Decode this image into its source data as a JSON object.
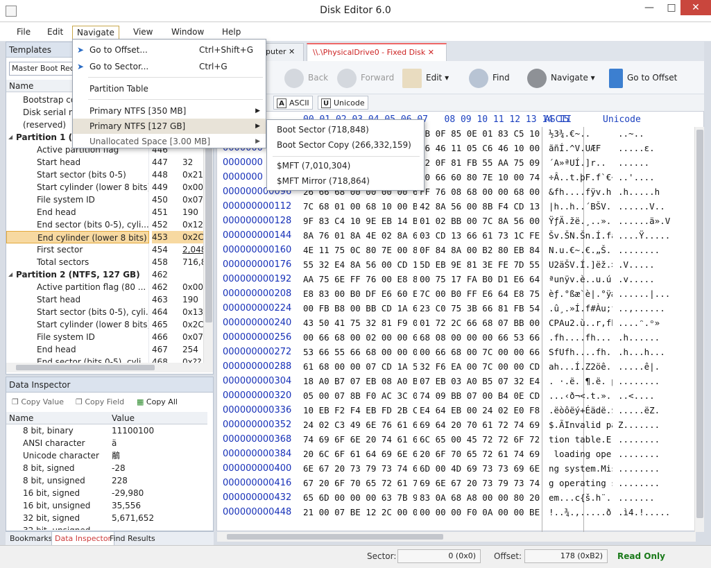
{
  "app": {
    "title": "Disk Editor 6.0"
  },
  "menubar": [
    "File",
    "Edit",
    "Navigate",
    "View",
    "Window",
    "Help"
  ],
  "templates": {
    "header": "Templates",
    "selected": "Master Boot Record",
    "col_name": "Name",
    "rows": [
      {
        "name": "Bootstrap co",
        "off": "",
        "val": "",
        "type": "item"
      },
      {
        "name": "Disk serial nun",
        "off": "",
        "val": "",
        "type": "item"
      },
      {
        "name": "(reserved)",
        "off": "",
        "val": "",
        "type": "item"
      },
      {
        "name": "Partition 1 (",
        "off": "",
        "val": "",
        "type": "group"
      },
      {
        "name": "Active partition flag",
        "off": "446",
        "val": "",
        "type": "sub"
      },
      {
        "name": "Start head",
        "off": "447",
        "val": "32",
        "type": "sub"
      },
      {
        "name": "Start sector (bits 0-5)",
        "off": "448",
        "val": "0x21",
        "type": "sub"
      },
      {
        "name": "Start cylinder (lower 8 bits)",
        "off": "449",
        "val": "0x00",
        "type": "sub"
      },
      {
        "name": "File system ID",
        "off": "450",
        "val": "0x07",
        "type": "sub"
      },
      {
        "name": "End head",
        "off": "451",
        "val": "190",
        "type": "sub"
      },
      {
        "name": "End sector (bits 0-5), cyli...",
        "off": "452",
        "val": "0x12",
        "type": "sub"
      },
      {
        "name": "End cylinder (lower 8 bits)",
        "off": "453",
        "val": "0x2C",
        "type": "hl"
      },
      {
        "name": "First sector",
        "off": "454",
        "val": "2,048",
        "type": "link"
      },
      {
        "name": "Total sectors",
        "off": "458",
        "val": "716,8",
        "type": "sub"
      },
      {
        "name": "Partition 2 (NTFS, 127 GB)",
        "off": "462",
        "val": "",
        "type": "group"
      },
      {
        "name": "Active partition flag (80 ...",
        "off": "462",
        "val": "0x00",
        "type": "sub"
      },
      {
        "name": "Start head",
        "off": "463",
        "val": "190",
        "type": "sub"
      },
      {
        "name": "Start sector (bits 0-5), cyli...",
        "off": "464",
        "val": "0x13",
        "type": "sub"
      },
      {
        "name": "Start cylinder (lower 8 bits)",
        "off": "465",
        "val": "0x2C",
        "type": "sub"
      },
      {
        "name": "File system ID",
        "off": "466",
        "val": "0x07",
        "type": "sub"
      },
      {
        "name": "End head",
        "off": "467",
        "val": "254",
        "type": "sub"
      },
      {
        "name": "End sector (bits 0-5), cyli...",
        "off": "468",
        "val": "0x??",
        "type": "sub"
      }
    ]
  },
  "inspector": {
    "header": "Data Inspector",
    "copy_value": "Copy Value",
    "copy_field": "Copy Field",
    "copy_all": "Copy All",
    "col_name": "Name",
    "col_value": "Value",
    "rows": [
      [
        "8 bit, binary",
        "11100100"
      ],
      [
        "ANSI character",
        "ä"
      ],
      [
        "Unicode character",
        "䳤"
      ],
      [
        "8 bit, signed",
        "-28"
      ],
      [
        "8 bit, unsigned",
        "228"
      ],
      [
        "16 bit, signed",
        "-29,980"
      ],
      [
        "16 bit, unsigned",
        "35,556"
      ],
      [
        "32 bit, signed",
        "5,671,652"
      ],
      [
        "32 bit, unsigned",
        ""
      ]
    ]
  },
  "bottom_tabs": [
    "Bookmarks",
    "Data Inspector",
    "Find Results"
  ],
  "doc_tabs": [
    "puter",
    "\\\\.\\PhysicalDrive0 - Fixed Disk"
  ],
  "toolbar": {
    "back": "Back",
    "forward": "Forward",
    "edit": "Edit",
    "find": "Find",
    "navigate": "Navigate",
    "goto": "Go to Offset"
  },
  "modes": {
    "ascii": "ASCII",
    "unicode": "Unicode"
  },
  "hex": {
    "header_cols": "00 01 02 03 04 05 06 07   08 09 10 11 12 13 14 15",
    "header_ascii": "ASCII",
    "header_unicode": "Unicode",
    "rows": [
      {
        "off": "0000000",
        "h1": "",
        "h2": "0B 0F 85 0E 01 83 C5 10",
        "asc": "½3¾.€~..",
        "uni": "..~.."
      },
      {
        "off": "0000000",
        "h1": "",
        "h2": "C6 46 11 05 C6 46 10 00",
        "asc": "ãñÍ.^V.UÆF",
        "uni": ".....ε."
      },
      {
        "off": "0000000",
        "h1": "",
        "h2": "72 0F 81 FB 55 AA 75 09",
        "asc": "´A»ªUÍ.]r..",
        "uni": "......"
      },
      {
        "off": "0000000",
        "h1": "",
        "h2": "10 66 60 80 7E 10 00 74",
        "asc": "÷Â..t.þF.f`€~.",
        "uni": "..'...."
      },
      {
        "off": "000000000096",
        "h1": "26 66 68 00 00 00 00 66",
        "h2": "FF 76 08 68 00 00 68 00",
        "asc": "&fh....fÿv.h..h.",
        "uni": ".h.....h"
      },
      {
        "off": "000000000112",
        "h1": "7C 68 01 00 68 10 00 B4",
        "h2": "42 8A 56 00 8B F4 CD 13",
        "asc": "|h..h..´BŠV.‹ôÍ.",
        "uni": "......V.."
      },
      {
        "off": "000000000128",
        "h1": "9F 83 C4 10 9E EB 14 B8",
        "h2": "01 02 BB 00 7C 8A 56 00",
        "asc": "ŸƒÄ.žë.¸..».|ŠV.",
        "uni": "......ä».V"
      },
      {
        "off": "000000000144",
        "h1": "8A 76 01 8A 4E 02 8A 6E",
        "h2": "03 CD 13 66 61 73 1C FE",
        "asc": "Šv.ŠN.Šn.Í.fas.þ",
        "uni": "....Ÿ....."
      },
      {
        "off": "000000000160",
        "h1": "4E 11 75 0C 80 7E 00 80",
        "h2": "0F 84 8A 00 B2 80 EB 84",
        "asc": "N.u.€~.€.„Š.²€ë„",
        "uni": "........"
      },
      {
        "off": "000000000176",
        "h1": "55 32 E4 8A 56 00 CD 13",
        "h2": "5D EB 9E 81 3E FE 7D 55",
        "asc": "U2äŠV.Í.]ëž.>þ}U",
        "uni": ".V....."
      },
      {
        "off": "000000000192",
        "h1": "AA 75 6E FF 76 00 E8 8D",
        "h2": "00 75 17 FA B0 D1 E6 64",
        "asc": "ªunÿv.è..u.ú°Ñæd",
        "uni": ".v....."
      },
      {
        "off": "000000000208",
        "h1": "E8 83 00 B0 DF E6 60 E8",
        "h2": "7C 00 B0 FF E6 64 E8 75",
        "asc": "èƒ.°ßæ`è|.°ÿædèu",
        "uni": "......|..."
      },
      {
        "off": "000000000224",
        "h1": "00 FB B8 00 BB CD 1A 66",
        "h2": "23 C0 75 3B 66 81 FB 54",
        "asc": ".û¸.»Í.f#Àu;f.ûT",
        "uni": "..,......"
      },
      {
        "off": "000000000240",
        "h1": "43 50 41 75 32 81 F9 02",
        "h2": "01 72 2C 66 68 07 BB 00",
        "asc": "CPAu2.ù..r,fh.».",
        "uni": "....ᵔ.ᵒ»"
      },
      {
        "off": "000000000256",
        "h1": "00 66 68 00 02 00 00 66",
        "h2": "68 08 00 00 00 66 53 66",
        "asc": ".fh....fh....fSf",
        "uni": ".h......"
      },
      {
        "off": "000000000272",
        "h1": "53 66 55 66 68 00 00 00",
        "h2": "00 66 68 00 7C 00 00 66",
        "asc": "SfUfh....fh.|..f",
        "uni": ".h...h..."
      },
      {
        "off": "000000000288",
        "h1": "61 68 00 00 07 CD 1A 5A",
        "h2": "32 F6 EA 00 7C 00 00 CD",
        "asc": "ah...Í.Z2öê.|..Í",
        "uni": ".....ê|."
      },
      {
        "off": "000000000304",
        "h1": "18 A0 B7 07 EB 08 A0 B6",
        "h2": "07 EB 03 A0 B5 07 32 E4",
        "asc": ". ·.ë. ¶.ë. µ.2ä",
        "uni": "........"
      },
      {
        "off": "000000000320",
        "h1": "05 00 07 8B F0 AC 3C 00",
        "h2": "74 09 BB 07 00 B4 0E CD",
        "asc": "...‹ð¬<.t.»..´.Í",
        "uni": "..<...."
      },
      {
        "off": "000000000336",
        "h1": "10 EB F2 F4 EB FD 2B C9",
        "h2": "E4 64 EB 00 24 02 E0 F8",
        "asc": ".ëòôëý+Éädë.$.àø",
        "uni": ".....ëZ."
      },
      {
        "off": "000000000352",
        "h1": "24 02 C3 49 6E 76 61 6C",
        "h2": "69 64 20 70 61 72 74 69",
        "asc": "$.ÃInvalid parti",
        "uni": "Z......."
      },
      {
        "off": "000000000368",
        "h1": "74 69 6F 6E 20 74 61 62",
        "h2": "6C 65 00 45 72 72 6F 72",
        "asc": "tion table.Error",
        "uni": "........"
      },
      {
        "off": "000000000384",
        "h1": "20 6C 6F 61 64 69 6E 67",
        "h2": "20 6F 70 65 72 61 74 69",
        "asc": " loading operati",
        "uni": "........"
      },
      {
        "off": "000000000400",
        "h1": "6E 67 20 73 79 73 74 65",
        "h2": "6D 00 4D 69 73 73 69 6E",
        "asc": "ng system.Missin",
        "uni": "........"
      },
      {
        "off": "000000000416",
        "h1": "67 20 6F 70 65 72 61 74",
        "h2": "69 6E 67 20 73 79 73 74",
        "asc": "g operating syst",
        "uni": "........"
      },
      {
        "off": "000000000432",
        "h1": "65 6D 00 00 00 63 7B 9A",
        "h2": "83 0A 68 A8 00 00 80 20",
        "asc": "em...c{š.h¨..€ ",
        "uni": "......."
      },
      {
        "off": "000000000448",
        "h1": "21 00 07 BE 12 2C 00 08",
        "h2": "00 00 00 F0 0A 00 00 BE",
        "asc": "!..¾.,.....ð...¾",
        "uni": ".ì4.!....."
      }
    ]
  },
  "navigate_menu": {
    "goto_offset": "Go to Offset...",
    "goto_offset_key": "Ctrl+Shift+G",
    "goto_sector": "Go to Sector...",
    "goto_sector_key": "Ctrl+G",
    "partition_table": "Partition Table",
    "primary1": "Primary NTFS [350 MB]",
    "primary2": "Primary NTFS [127 GB]",
    "unallocated": "Unallocated Space [3.00 MB]"
  },
  "submenu": {
    "boot_sector": "Boot Sector (718,848)",
    "boot_copy": "Boot Sector Copy (266,332,159)",
    "mft": "$MFT (7,010,304)",
    "mft_mirror": "$MFT Mirror (718,864)"
  },
  "status": {
    "sector_label": "Sector:",
    "sector_value": "0 (0x0)",
    "offset_label": "Offset:",
    "offset_value": "178 (0xB2)",
    "mode": "Read Only"
  },
  "colors": {
    "accent": "#c22222",
    "link": "#0645ad",
    "highlight": "#f7d9a1"
  }
}
